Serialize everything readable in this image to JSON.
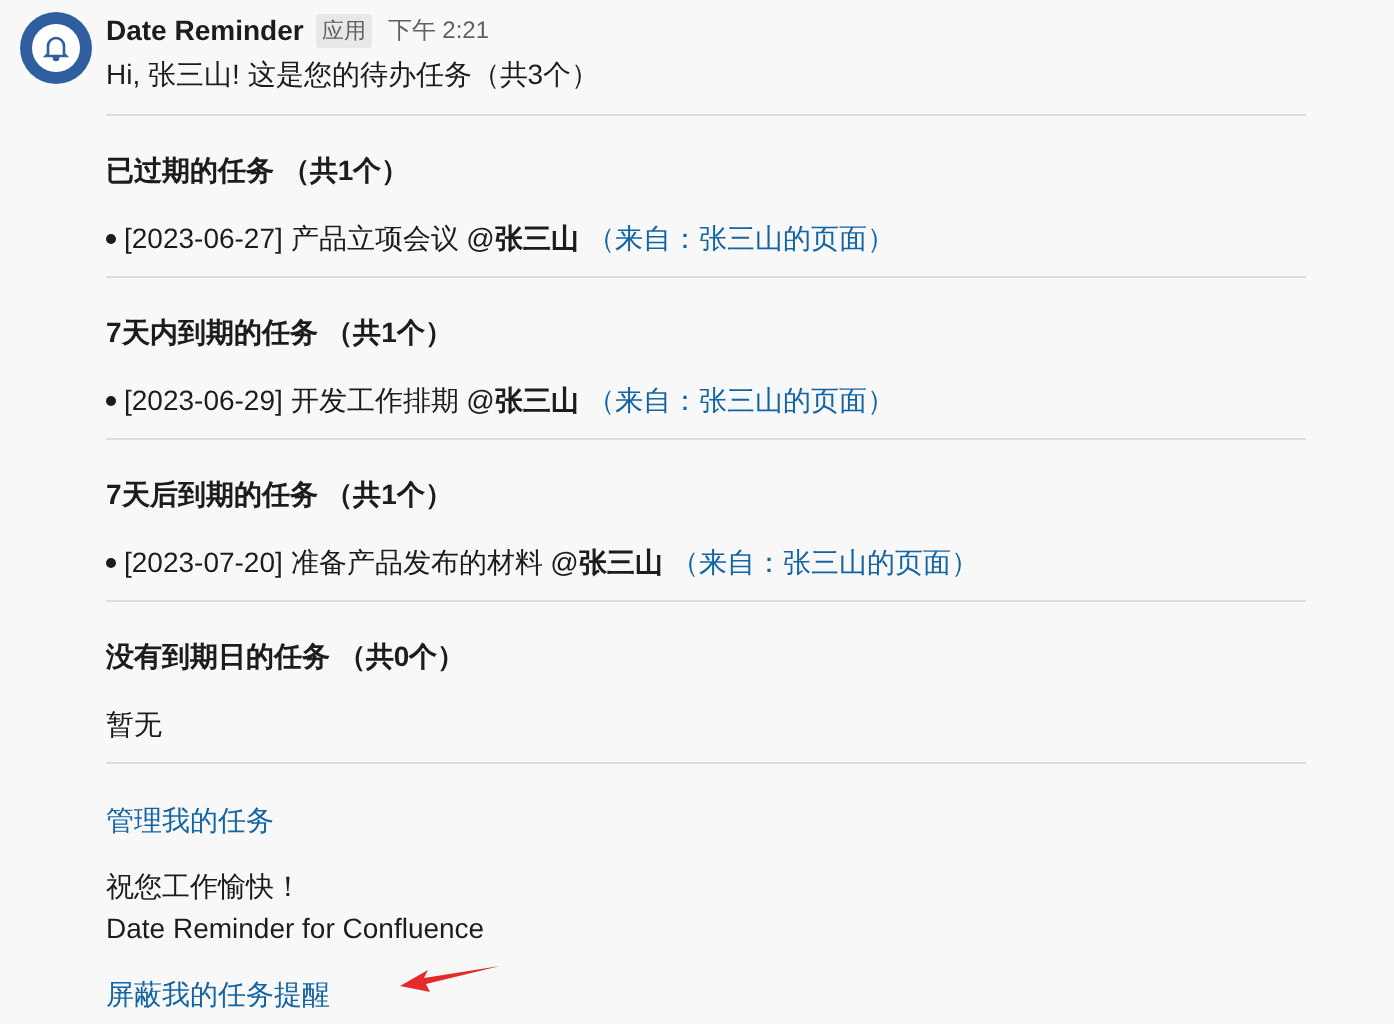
{
  "message": {
    "sender": "Date Reminder",
    "badge": "应用",
    "time": "下午 2:21",
    "greeting": "Hi, 张三山! 这是您的待办任务（共3个）"
  },
  "sections": [
    {
      "title": "已过期的任务 （共1个）",
      "items": [
        {
          "text": "[2023-06-27] 产品立项会议 @**张三山**",
          "source": "（来自：张三山的页面）"
        }
      ]
    },
    {
      "title": "7天内到期的任务 （共1个）",
      "items": [
        {
          "text": "[2023-06-29] 开发工作排期 @**张三山**",
          "source": "（来自：张三山的页面）"
        }
      ]
    },
    {
      "title": "7天后到期的任务 （共1个）",
      "items": [
        {
          "text": "[2023-07-20] 准备产品发布的材料 @**张三山**",
          "source": "（来自：张三山的页面）"
        }
      ]
    },
    {
      "title": "没有到期日的任务 （共0个）",
      "empty_text": "暂无"
    }
  ],
  "manage_link": "管理我的任务",
  "closing": "祝您工作愉快！",
  "signature": "Date Reminder for Confluence",
  "mute_link": "屏蔽我的任务提醒"
}
